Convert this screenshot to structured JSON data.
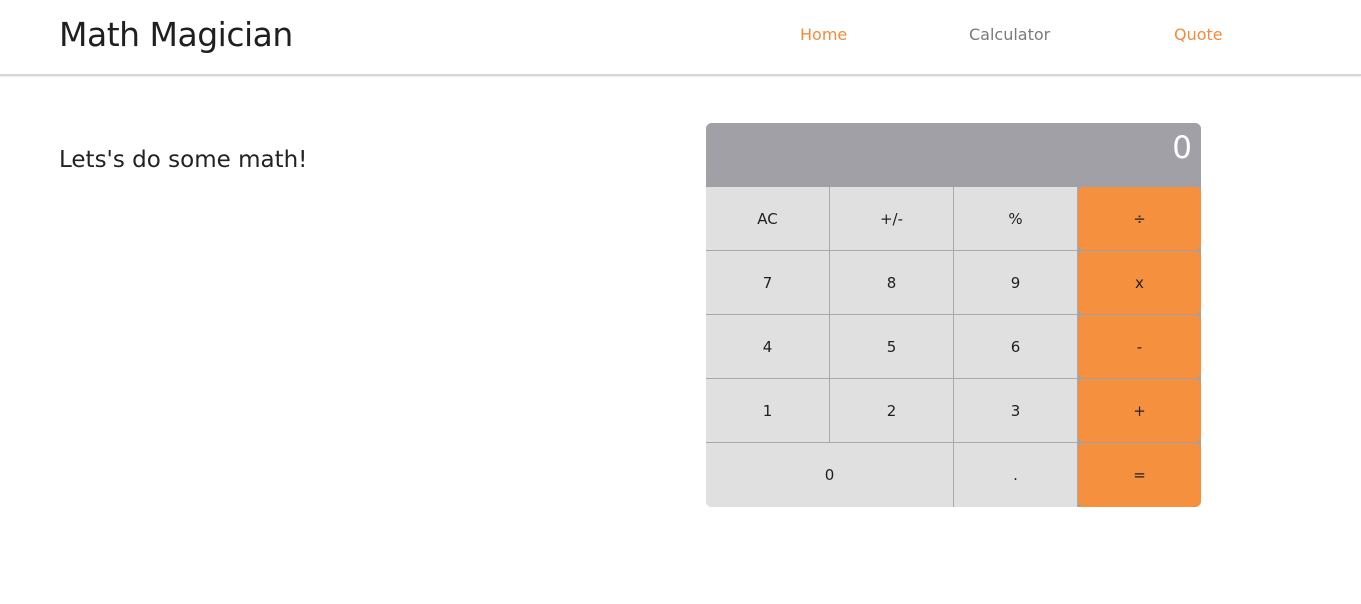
{
  "header": {
    "brand": "Math Magician",
    "nav": [
      {
        "label": "Home"
      },
      {
        "label": "Calculator"
      },
      {
        "label": "Quote"
      }
    ]
  },
  "main": {
    "heading": "Lets's do some math!"
  },
  "calculator": {
    "display": "0",
    "keys": {
      "ac": "AC",
      "sign": "+/-",
      "percent": "%",
      "divide": "÷",
      "seven": "7",
      "eight": "8",
      "nine": "9",
      "multiply": "x",
      "four": "4",
      "five": "5",
      "six": "6",
      "subtract": "-",
      "one": "1",
      "two": "2",
      "three": "3",
      "add": "+",
      "zero": "0",
      "decimal": ".",
      "equals": "="
    }
  },
  "colors": {
    "accent": "#f28c3c",
    "operator": "#f5913e",
    "display_bg": "#a1a0a7",
    "key_bg": "#e0e0e0",
    "nav_inactive": "#7a7a7a"
  }
}
